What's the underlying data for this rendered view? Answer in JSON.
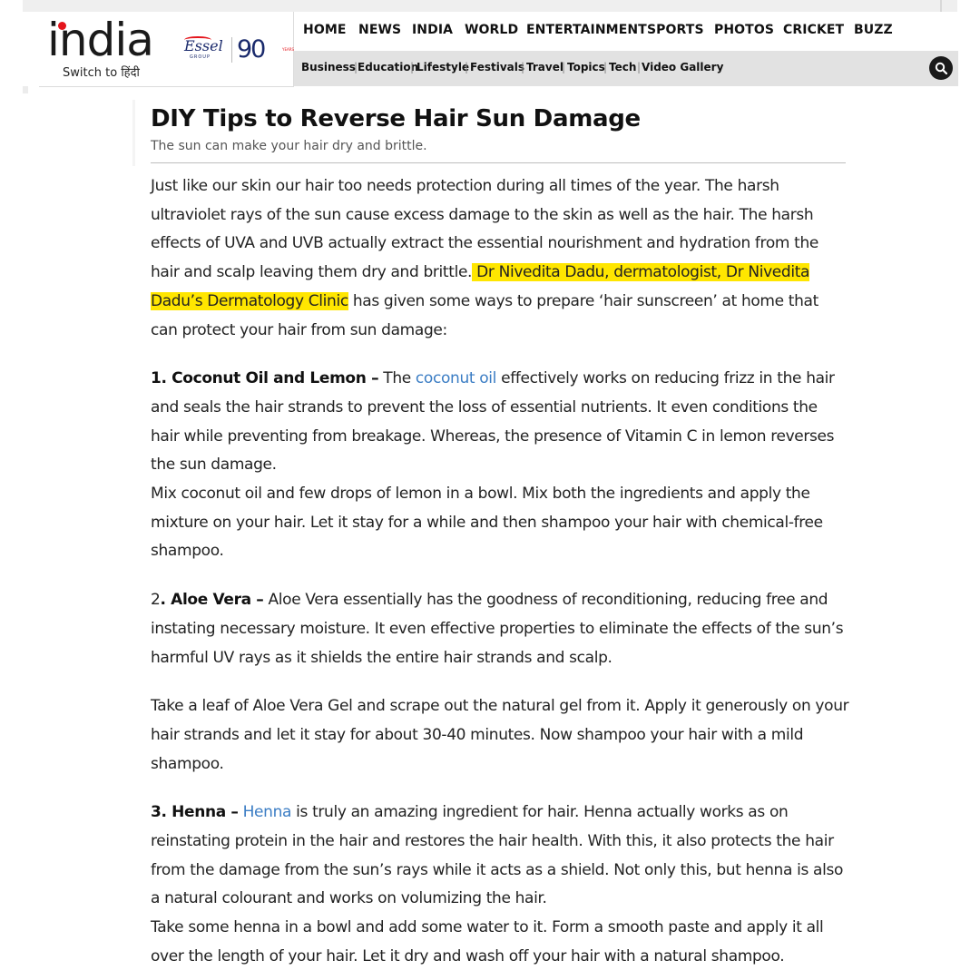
{
  "site": {
    "logo_text": "india",
    "switch_prefix": "Switch to",
    "switch_lang": "हिंदी",
    "partner_logo_text": "Essel",
    "partner_logo_subtext": "GROUP",
    "anniversary_text": "90",
    "anniversary_subtext": "YEARS"
  },
  "nav": {
    "main": [
      "HOME",
      "NEWS",
      "INDIA",
      "WORLD",
      "ENTERTAINMENT",
      "SPORTS",
      "PHOTOS",
      "CRICKET",
      "BUZZ"
    ],
    "sub": [
      "Business",
      "Education",
      "Lifestyle",
      "Festivals",
      "Travel",
      "Topics",
      "Tech",
      "Video Gallery"
    ]
  },
  "article": {
    "title": "DIY Tips to Reverse Hair Sun Damage",
    "subtitle": "The sun can make your hair dry and brittle.",
    "intro": {
      "text_before": "Just like our skin our hair too needs protection during all times of the year. The harsh ultraviolet rays of the sun cause excess damage to the skin as well as the hair. The harsh effects of UVA and UVB actually extract the essential nourishment and hydration from the hair and scalp leaving them dry and brittle.",
      "highlight": " Dr Nivedita Dadu, dermatologist, Dr Nivedita Dadu’s Dermatology Clinic",
      "text_after": " has given some ways to prepare  ‘hair sunscreen’ at home that can protect your hair from sun damage:"
    },
    "tip1": {
      "heading": "1. Coconut Oil and Lemon –",
      "text_before": " The ",
      "link": "coconut oil",
      "text_after": " effectively works on reducing frizz in the hair and seals the hair strands to prevent the loss of essential nutrients. It even conditions the hair while preventing from breakage. Whereas, the presence of Vitamin C in lemon reverses the sun damage.",
      "method": "Mix coconut oil and few drops of lemon in a bowl. Mix both the ingredients and apply the mixture on your hair. Let it stay for a while and then shampoo your hair with chemical-free shampoo."
    },
    "tip2": {
      "number": "2",
      "heading": ". Aloe Vera –",
      "text": " Aloe Vera essentially has the goodness of reconditioning, reducing free and instating necessary moisture. It even effective properties to eliminate the effects of the sun’s harmful UV rays as it shields the entire hair strands and scalp.",
      "method": "Take a leaf of Aloe Vera Gel and scrape out the natural gel from it. Apply it generously on your hair strands and let it stay for about 30-40 minutes. Now shampoo your hair with a mild shampoo."
    },
    "tip3": {
      "heading": "3. Henna –",
      "link": "Henna",
      "text_after": " is truly an amazing ingredient for hair. Henna actually works as on reinstating protein in the hair and restores the hair health. With this, it also protects the hair from the damage from the sun’s rays while it acts as a shield. Not only this, but henna is also a natural colourant and works on volumizing the hair.",
      "method": "Take some henna in a bowl and add some water to it. Form a smooth paste and apply it all over the length of your hair. Let it dry and wash off your hair with a natural shampoo."
    }
  },
  "colors": {
    "highlight": "#ffe600",
    "link": "#3b7dc4",
    "brand_red": "#e4141b",
    "subnav_bg": "#e2e2e2"
  }
}
